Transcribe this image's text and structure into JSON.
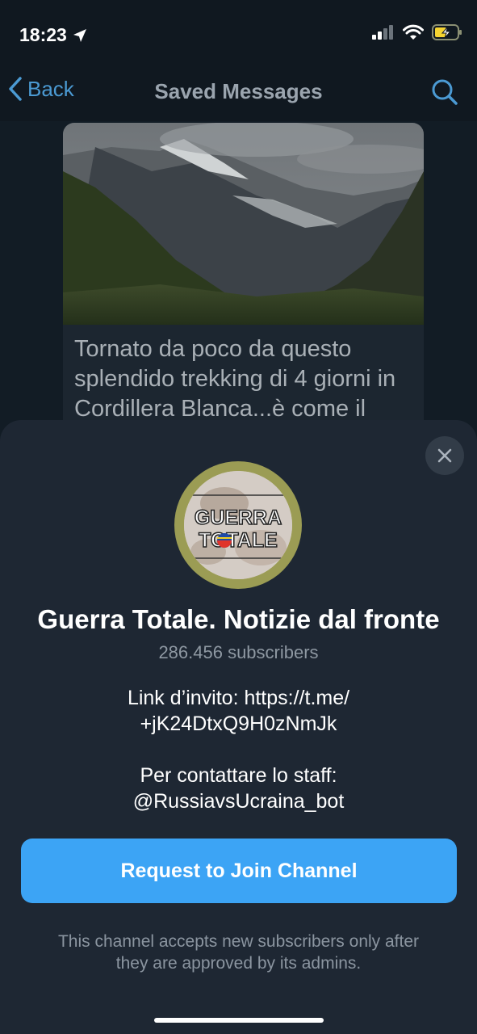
{
  "status_bar": {
    "time": "18:23",
    "icons": [
      "location-arrow-icon",
      "cellular-signal-icon",
      "wifi-icon",
      "battery-charging-icon"
    ]
  },
  "nav": {
    "back_label": "Back",
    "title": "Saved Messages",
    "search_icon": "search-icon"
  },
  "message": {
    "text": "Tornato da poco da questo splendido trekking di 4 giorni in Cordillera Blanca...è come il"
  },
  "sheet": {
    "channel_name": "Guerra Totale. Notizie dal fronte",
    "avatar_logo_text": [
      "GUERRA",
      "TOTALE"
    ],
    "subscribers": "286.456 subscribers",
    "description_line1a": "Link d’invito: https://t.me/",
    "description_line1b": "+jK24DtxQ9H0zNmJk",
    "description_line2a": "Per contattare lo staff:",
    "description_line2b": "@RussiavsUcraina_bot",
    "join_button": "Request to Join Channel",
    "note": "This channel accepts new subscribers only after they are approved by its admins."
  },
  "colors": {
    "accent": "#3ca4f5",
    "nav_link": "#4b9ad3",
    "sheet_bg": "#1e2733",
    "battery": "#f5d431"
  }
}
